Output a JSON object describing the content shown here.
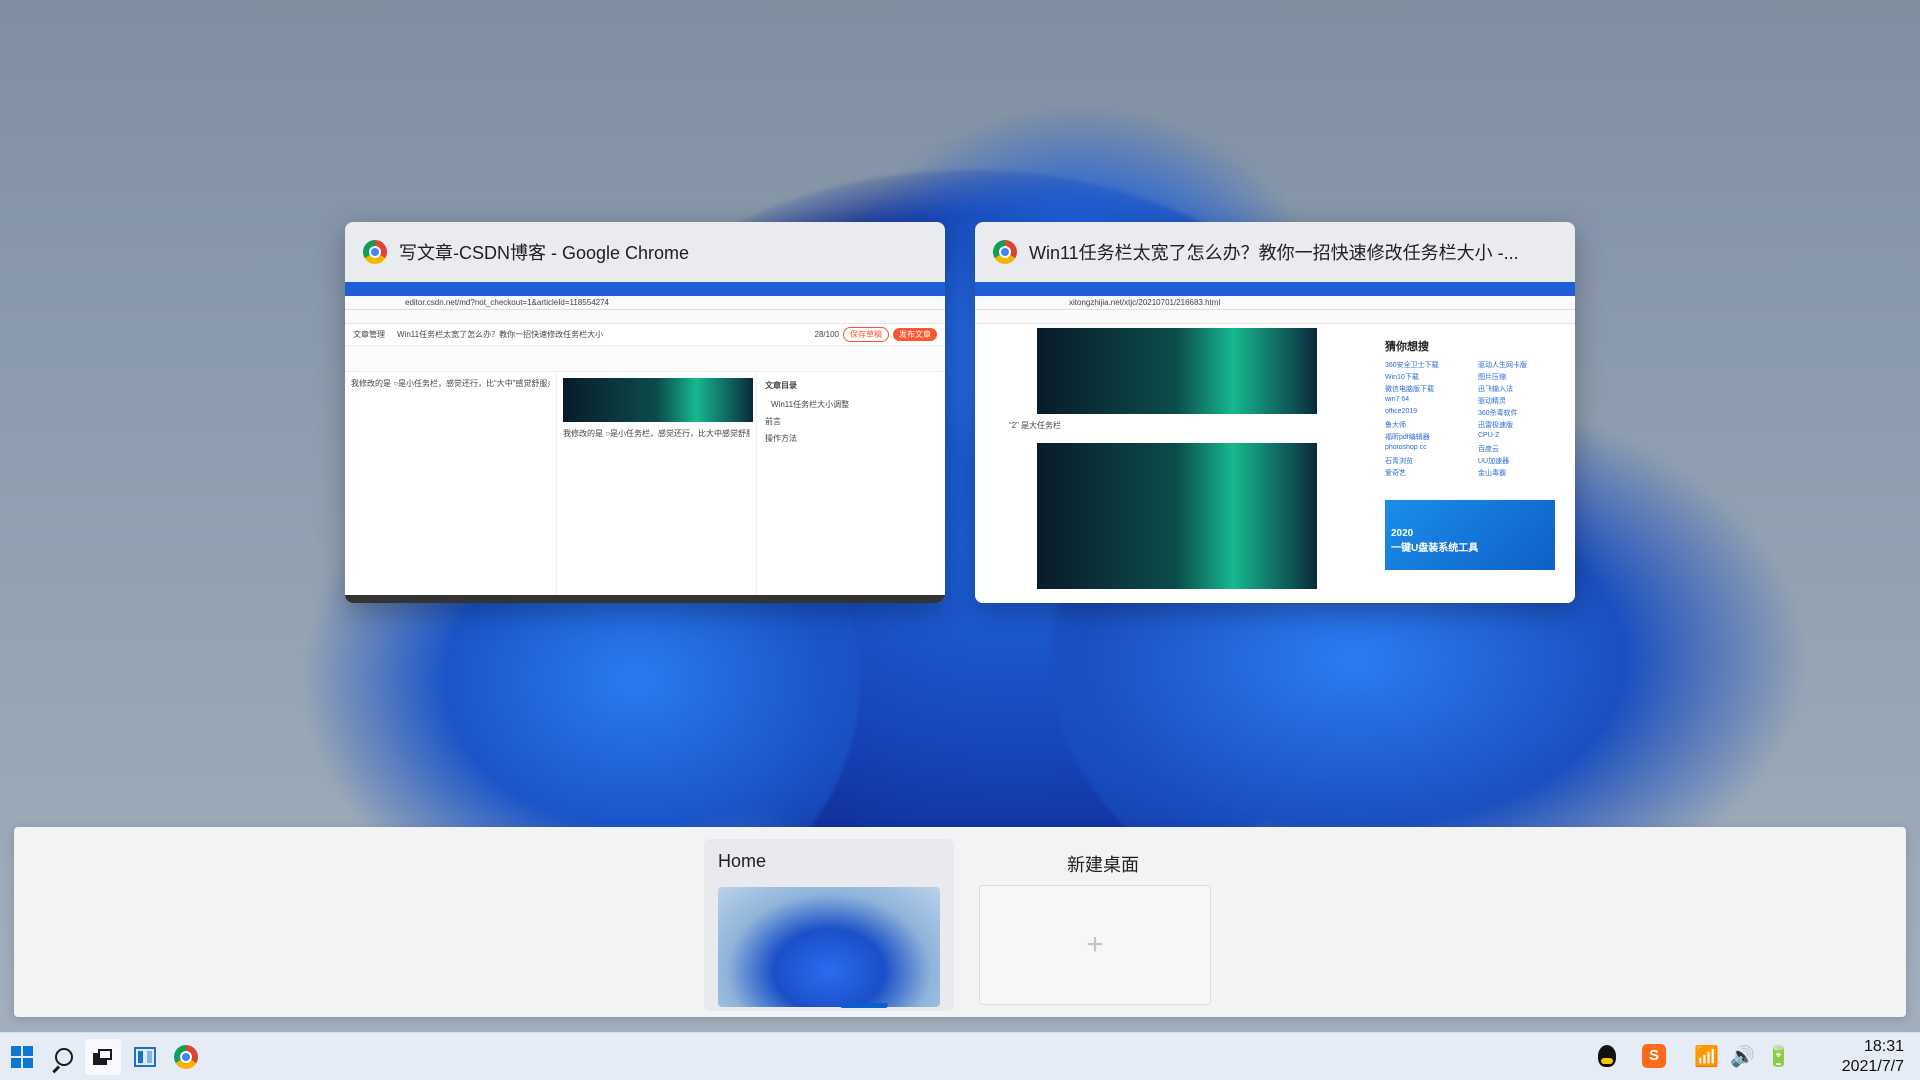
{
  "windows": [
    {
      "title": "写文章-CSDN博客 - Google Chrome",
      "icon": "chrome-icon",
      "content": {
        "url": "editor.csdn.net/md?not_checkout=1&articleId=118554274",
        "back_label": "文章管理",
        "article_title": "Win11任务栏太宽了怎么办？教你一招快速修改任务栏大小",
        "count": "28/100",
        "save_draft": "保存草稿",
        "publish": "发布文章",
        "editor_text": "我修改的是 ○是小任务栏，感觉还行，比“大中”感觉舒服点",
        "preview_text": "我修改的是 ○是小任务栏，感觉还行，比大中感觉舒服点",
        "toc_title": "文章目录",
        "toc_items": [
          "Win11任务栏大小调整",
          "前言",
          "操作方法"
        ]
      }
    },
    {
      "title": "Win11任务栏太宽了怎么办？教你一招快速修改任务栏大小 -...",
      "icon": "chrome-icon",
      "content": {
        "url": "xitongzhijia.net/xtjc/20210701/216683.html",
        "caption": "“2” 是大任务栏",
        "sidebar_title": "猜你想搜",
        "sidebar_items": [
          "360安全卫士下载",
          "驱动人生网卡版",
          "Win10下载",
          "图片压缩",
          "微信电脑版下载",
          "迅飞输入法",
          "win7 64",
          "驱动精灵",
          "office2019",
          "360杀毒软件",
          "鲁大师",
          "迅雷极速版",
          "福昕pdf编辑器",
          "CPU-Z",
          "photoshop cc",
          "百度云",
          "石青浏览",
          "UU加速器",
          "爱奇艺",
          "金山毒霸"
        ],
        "ad_year": "2020",
        "ad_text": "一键U盘装系统工具"
      }
    }
  ],
  "desktops": {
    "home_label": "Home",
    "new_label": "新建桌面",
    "new_icon": "plus-icon"
  },
  "taskbar": {
    "icons": [
      "start-icon",
      "search-icon",
      "taskview-icon",
      "widgets-icon",
      "chrome-icon"
    ],
    "tray": [
      "qq-icon",
      "sogou-icon",
      "wifi-icon",
      "volume-icon",
      "battery-icon"
    ],
    "time": "18:31",
    "date": "2021/7/7"
  }
}
